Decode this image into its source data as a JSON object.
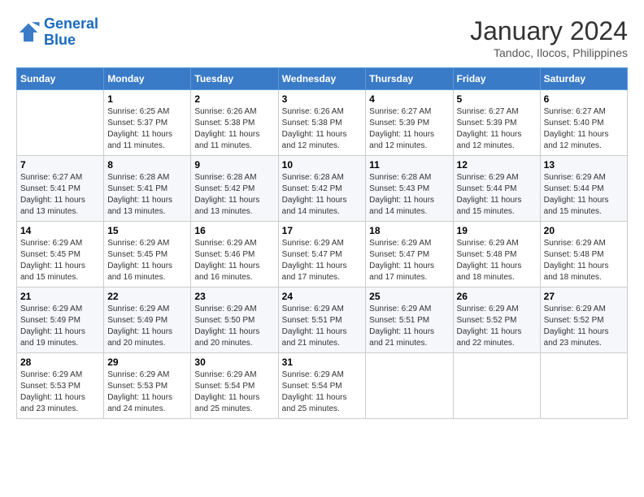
{
  "logo": {
    "line1": "General",
    "line2": "Blue"
  },
  "title": "January 2024",
  "subtitle": "Tandoc, Ilocos, Philippines",
  "days_of_week": [
    "Sunday",
    "Monday",
    "Tuesday",
    "Wednesday",
    "Thursday",
    "Friday",
    "Saturday"
  ],
  "weeks": [
    [
      {
        "day": "",
        "sunrise": "",
        "sunset": "",
        "daylight": ""
      },
      {
        "day": "1",
        "sunrise": "Sunrise: 6:25 AM",
        "sunset": "Sunset: 5:37 PM",
        "daylight": "Daylight: 11 hours and 11 minutes."
      },
      {
        "day": "2",
        "sunrise": "Sunrise: 6:26 AM",
        "sunset": "Sunset: 5:38 PM",
        "daylight": "Daylight: 11 hours and 11 minutes."
      },
      {
        "day": "3",
        "sunrise": "Sunrise: 6:26 AM",
        "sunset": "Sunset: 5:38 PM",
        "daylight": "Daylight: 11 hours and 12 minutes."
      },
      {
        "day": "4",
        "sunrise": "Sunrise: 6:27 AM",
        "sunset": "Sunset: 5:39 PM",
        "daylight": "Daylight: 11 hours and 12 minutes."
      },
      {
        "day": "5",
        "sunrise": "Sunrise: 6:27 AM",
        "sunset": "Sunset: 5:39 PM",
        "daylight": "Daylight: 11 hours and 12 minutes."
      },
      {
        "day": "6",
        "sunrise": "Sunrise: 6:27 AM",
        "sunset": "Sunset: 5:40 PM",
        "daylight": "Daylight: 11 hours and 12 minutes."
      }
    ],
    [
      {
        "day": "7",
        "sunrise": "Sunrise: 6:27 AM",
        "sunset": "Sunset: 5:41 PM",
        "daylight": "Daylight: 11 hours and 13 minutes."
      },
      {
        "day": "8",
        "sunrise": "Sunrise: 6:28 AM",
        "sunset": "Sunset: 5:41 PM",
        "daylight": "Daylight: 11 hours and 13 minutes."
      },
      {
        "day": "9",
        "sunrise": "Sunrise: 6:28 AM",
        "sunset": "Sunset: 5:42 PM",
        "daylight": "Daylight: 11 hours and 13 minutes."
      },
      {
        "day": "10",
        "sunrise": "Sunrise: 6:28 AM",
        "sunset": "Sunset: 5:42 PM",
        "daylight": "Daylight: 11 hours and 14 minutes."
      },
      {
        "day": "11",
        "sunrise": "Sunrise: 6:28 AM",
        "sunset": "Sunset: 5:43 PM",
        "daylight": "Daylight: 11 hours and 14 minutes."
      },
      {
        "day": "12",
        "sunrise": "Sunrise: 6:29 AM",
        "sunset": "Sunset: 5:44 PM",
        "daylight": "Daylight: 11 hours and 15 minutes."
      },
      {
        "day": "13",
        "sunrise": "Sunrise: 6:29 AM",
        "sunset": "Sunset: 5:44 PM",
        "daylight": "Daylight: 11 hours and 15 minutes."
      }
    ],
    [
      {
        "day": "14",
        "sunrise": "Sunrise: 6:29 AM",
        "sunset": "Sunset: 5:45 PM",
        "daylight": "Daylight: 11 hours and 15 minutes."
      },
      {
        "day": "15",
        "sunrise": "Sunrise: 6:29 AM",
        "sunset": "Sunset: 5:45 PM",
        "daylight": "Daylight: 11 hours and 16 minutes."
      },
      {
        "day": "16",
        "sunrise": "Sunrise: 6:29 AM",
        "sunset": "Sunset: 5:46 PM",
        "daylight": "Daylight: 11 hours and 16 minutes."
      },
      {
        "day": "17",
        "sunrise": "Sunrise: 6:29 AM",
        "sunset": "Sunset: 5:47 PM",
        "daylight": "Daylight: 11 hours and 17 minutes."
      },
      {
        "day": "18",
        "sunrise": "Sunrise: 6:29 AM",
        "sunset": "Sunset: 5:47 PM",
        "daylight": "Daylight: 11 hours and 17 minutes."
      },
      {
        "day": "19",
        "sunrise": "Sunrise: 6:29 AM",
        "sunset": "Sunset: 5:48 PM",
        "daylight": "Daylight: 11 hours and 18 minutes."
      },
      {
        "day": "20",
        "sunrise": "Sunrise: 6:29 AM",
        "sunset": "Sunset: 5:48 PM",
        "daylight": "Daylight: 11 hours and 18 minutes."
      }
    ],
    [
      {
        "day": "21",
        "sunrise": "Sunrise: 6:29 AM",
        "sunset": "Sunset: 5:49 PM",
        "daylight": "Daylight: 11 hours and 19 minutes."
      },
      {
        "day": "22",
        "sunrise": "Sunrise: 6:29 AM",
        "sunset": "Sunset: 5:49 PM",
        "daylight": "Daylight: 11 hours and 20 minutes."
      },
      {
        "day": "23",
        "sunrise": "Sunrise: 6:29 AM",
        "sunset": "Sunset: 5:50 PM",
        "daylight": "Daylight: 11 hours and 20 minutes."
      },
      {
        "day": "24",
        "sunrise": "Sunrise: 6:29 AM",
        "sunset": "Sunset: 5:51 PM",
        "daylight": "Daylight: 11 hours and 21 minutes."
      },
      {
        "day": "25",
        "sunrise": "Sunrise: 6:29 AM",
        "sunset": "Sunset: 5:51 PM",
        "daylight": "Daylight: 11 hours and 21 minutes."
      },
      {
        "day": "26",
        "sunrise": "Sunrise: 6:29 AM",
        "sunset": "Sunset: 5:52 PM",
        "daylight": "Daylight: 11 hours and 22 minutes."
      },
      {
        "day": "27",
        "sunrise": "Sunrise: 6:29 AM",
        "sunset": "Sunset: 5:52 PM",
        "daylight": "Daylight: 11 hours and 23 minutes."
      }
    ],
    [
      {
        "day": "28",
        "sunrise": "Sunrise: 6:29 AM",
        "sunset": "Sunset: 5:53 PM",
        "daylight": "Daylight: 11 hours and 23 minutes."
      },
      {
        "day": "29",
        "sunrise": "Sunrise: 6:29 AM",
        "sunset": "Sunset: 5:53 PM",
        "daylight": "Daylight: 11 hours and 24 minutes."
      },
      {
        "day": "30",
        "sunrise": "Sunrise: 6:29 AM",
        "sunset": "Sunset: 5:54 PM",
        "daylight": "Daylight: 11 hours and 25 minutes."
      },
      {
        "day": "31",
        "sunrise": "Sunrise: 6:29 AM",
        "sunset": "Sunset: 5:54 PM",
        "daylight": "Daylight: 11 hours and 25 minutes."
      },
      {
        "day": "",
        "sunrise": "",
        "sunset": "",
        "daylight": ""
      },
      {
        "day": "",
        "sunrise": "",
        "sunset": "",
        "daylight": ""
      },
      {
        "day": "",
        "sunrise": "",
        "sunset": "",
        "daylight": ""
      }
    ]
  ]
}
